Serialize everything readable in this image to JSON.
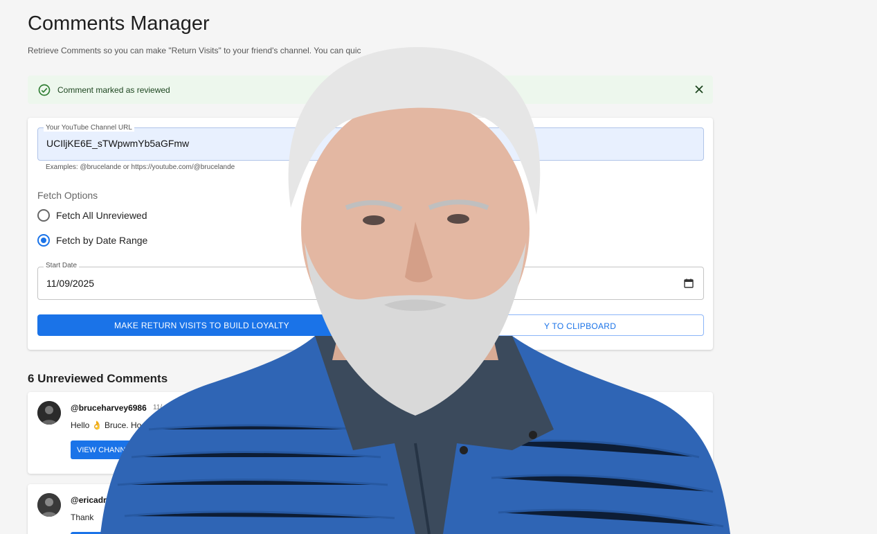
{
  "page": {
    "title": "Comments Manager",
    "subtitle": "Retrieve Comments so you can make \"Return Visits\" to your friend's channel. You can quic"
  },
  "alert": {
    "message": "Comment marked as reviewed",
    "color": "#edf7ed"
  },
  "form": {
    "url_label": "Your YouTube Channel URL",
    "url_value": "UCIljKE6E_sTWpwmYb5aGFmw",
    "url_helper": "Examples: @brucelande or https://youtube.com/@brucelande",
    "fetch_title": "Fetch Options",
    "options": [
      {
        "label": "Fetch All Unreviewed",
        "selected": false
      },
      {
        "label": "Fetch by Date Range",
        "selected": true
      }
    ],
    "start_date_label": "Start Date",
    "start_date_value": "11/09/2025",
    "primary_button": "MAKE RETURN VISITS TO BUILD LOYALTY",
    "secondary_button": "Y TO CLIPBOARD"
  },
  "comments": {
    "heading": "6 Unreviewed Comments",
    "items": [
      {
        "author": "@bruceharvey6986",
        "date": "11/",
        "text": "Hello 👌 Bruce. Ho",
        "button": "VIEW CHANN"
      },
      {
        "author": "@ericadr",
        "text": "Thank "
      }
    ]
  },
  "colors": {
    "accent": "#1a73e8",
    "background": "#f5f5f5",
    "success_icon": "#2e7d32"
  }
}
